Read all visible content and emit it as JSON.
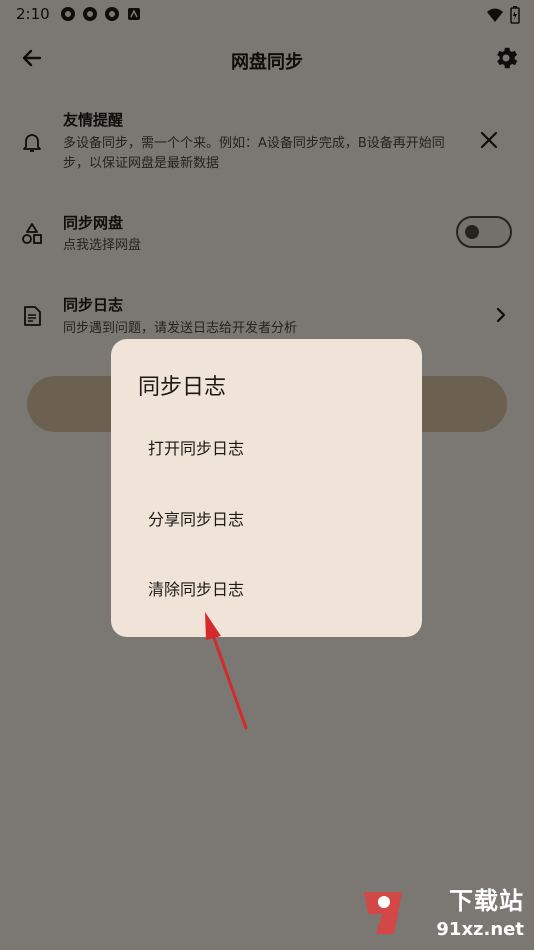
{
  "status_bar": {
    "time": "2:10"
  },
  "app_bar": {
    "title": "网盘同步"
  },
  "reminder": {
    "title": "友情提醒",
    "line1": "多设备同步，需一个个来。例如：A设备同步完成，B设备再开始同",
    "line2": "步，以保证网盘是最新数据"
  },
  "sync_drive": {
    "title": "同步网盘",
    "subtitle": "点我选择网盘",
    "enabled": false
  },
  "sync_log": {
    "title": "同步日志",
    "subtitle": "同步遇到问题，请发送日志给开发者分析"
  },
  "dialog": {
    "title": "同步日志",
    "items": [
      "打开同步日志",
      "分享同步日志",
      "清除同步日志"
    ]
  },
  "watermark": {
    "top": "下载站",
    "bottom": "91xz.net"
  },
  "colors": {
    "background": "#f7efe6",
    "dialog": "#f0e4d9",
    "arrow": "#d42a2a",
    "accent_button": "#d9c3a0"
  }
}
